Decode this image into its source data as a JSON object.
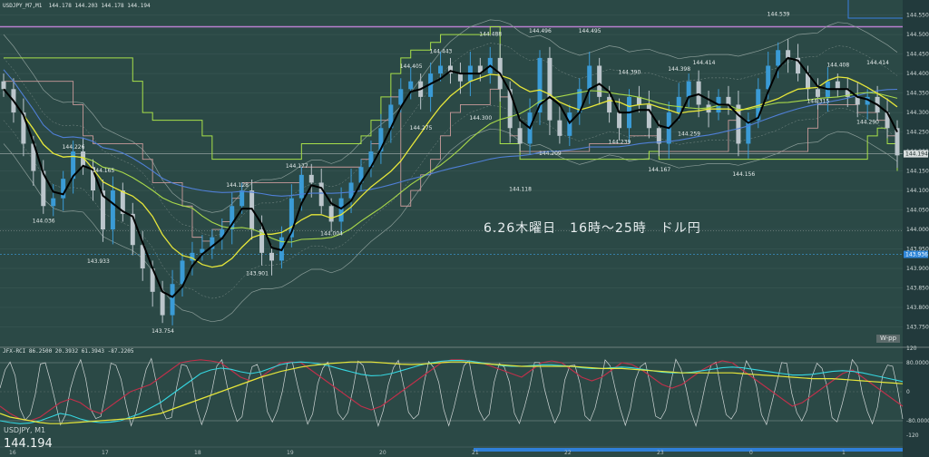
{
  "header": {
    "main_caption": "USDJPY_M7,M1  144.178 144.203 144.178 144.194",
    "oscillator_caption": "JFX-RCI 86.2500 20.3932 61.3943 -87.2205"
  },
  "annotation": "6.26木曜日　16時～25時　ドル円",
  "bottom_symbol": "USDJPY, M1",
  "bottom_price": "144.194",
  "wpp_tag": "W-pp",
  "current_price_label": "144.194",
  "blue_line_label": "143.936",
  "colors": {
    "background": "#2b4946",
    "candle_up": "#3a9bd6",
    "candle_down": "#bcc6cc",
    "ma_fast": "#000000",
    "ma_mid": "#e6e63a",
    "ma_slow": "#a8d84a",
    "ma_long": "#4f7fd6",
    "step_green": "#a8e04a",
    "step_pink": "#c99a9a",
    "rci_cyan": "#35d6e0",
    "rci_red": "#c0304a",
    "rci_yellow": "#e6e63a",
    "rci_white": "#cfd6d6",
    "level_purple": "#b97fd0"
  },
  "chart_data": [
    {
      "type": "line",
      "title": "USDJPY, M1",
      "ylim": [
        143.7,
        144.57
      ],
      "y_ticks": [
        "144.550",
        "144.500",
        "144.450",
        "144.400",
        "144.350",
        "144.300",
        "144.250",
        "144.200",
        "144.150",
        "144.100",
        "144.050",
        "144.000",
        "143.950",
        "143.900",
        "143.850",
        "143.800",
        "143.750"
      ],
      "x_ticks": [
        "16",
        "17",
        "18",
        "19",
        "20",
        "21",
        "22",
        "23",
        "0",
        "1"
      ],
      "price_labels": [
        {
          "t": 4,
          "v": 144.036,
          "text": "144.036"
        },
        {
          "t": 7,
          "v": 144.226,
          "text": "144.226"
        },
        {
          "t": 9.5,
          "v": 143.933,
          "text": "143.933"
        },
        {
          "t": 10,
          "v": 144.165,
          "text": "144.165"
        },
        {
          "t": 16,
          "v": 143.754,
          "text": "143.754"
        },
        {
          "t": 23.5,
          "v": 144.128,
          "text": "144.128"
        },
        {
          "t": 25.5,
          "v": 143.901,
          "text": "143.901"
        },
        {
          "t": 29.5,
          "v": 144.177,
          "text": "144.177"
        },
        {
          "t": 33,
          "v": 144.004,
          "text": "144.004"
        },
        {
          "t": 41,
          "v": 144.405,
          "text": "144.405"
        },
        {
          "t": 42,
          "v": 144.275,
          "text": "144.275"
        },
        {
          "t": 44,
          "v": 144.443,
          "text": "144.443"
        },
        {
          "t": 48,
          "v": 144.3,
          "text": "144.300"
        },
        {
          "t": 49,
          "v": 144.488,
          "text": "144.488"
        },
        {
          "t": 52,
          "v": 144.118,
          "text": "144.118"
        },
        {
          "t": 54,
          "v": 144.496,
          "text": "144.496"
        },
        {
          "t": 55,
          "v": 144.209,
          "text": "144.209"
        },
        {
          "t": 59,
          "v": 144.495,
          "text": "144.495"
        },
        {
          "t": 62,
          "v": 144.239,
          "text": "144.239"
        },
        {
          "t": 63,
          "v": 144.39,
          "text": "144.390"
        },
        {
          "t": 66,
          "v": 144.167,
          "text": "144.167"
        },
        {
          "t": 68,
          "v": 144.398,
          "text": "144.398"
        },
        {
          "t": 69,
          "v": 144.259,
          "text": "144.259"
        },
        {
          "t": 70.5,
          "v": 144.414,
          "text": "144.414"
        },
        {
          "t": 74.5,
          "v": 144.156,
          "text": "144.156"
        },
        {
          "t": 78,
          "v": 144.539,
          "text": "144.539"
        },
        {
          "t": 82,
          "v": 144.315,
          "text": "144.315"
        },
        {
          "t": 84,
          "v": 144.408,
          "text": "144.408"
        },
        {
          "t": 87,
          "v": 144.29,
          "text": "144.290"
        },
        {
          "t": 88,
          "v": 144.414,
          "text": "144.414"
        }
      ],
      "close": [
        144.36,
        144.3,
        144.22,
        144.15,
        144.06,
        144.08,
        144.13,
        144.2,
        144.16,
        144.1,
        144.0,
        144.1,
        144.04,
        143.96,
        143.9,
        143.84,
        143.78,
        143.86,
        143.92,
        143.94,
        143.95,
        143.98,
        144.0,
        144.06,
        144.1,
        144.0,
        143.94,
        143.92,
        143.98,
        144.08,
        144.14,
        144.12,
        144.06,
        144.02,
        144.08,
        144.12,
        144.16,
        144.2,
        144.26,
        144.32,
        144.36,
        144.38,
        144.34,
        144.4,
        144.42,
        144.4,
        144.38,
        144.42,
        144.4,
        144.44,
        144.36,
        144.26,
        144.22,
        144.3,
        144.44,
        144.28,
        144.24,
        144.3,
        144.36,
        144.42,
        144.34,
        144.3,
        144.26,
        144.34,
        144.32,
        144.26,
        144.22,
        144.3,
        144.34,
        144.38,
        144.32,
        144.3,
        144.34,
        144.32,
        144.22,
        144.28,
        144.36,
        144.42,
        144.46,
        144.44,
        144.4,
        144.36,
        144.34,
        144.38,
        144.36,
        144.34,
        144.32,
        144.34,
        144.3,
        144.26,
        144.19
      ]
    },
    {
      "type": "line",
      "title": "JFX-RCI",
      "ylim": [
        -120,
        120
      ],
      "y_ticks": [
        "120",
        "80.0000",
        "0",
        "-80.0000",
        "-120"
      ],
      "series": [
        {
          "values": [
            -40,
            -60,
            -75,
            -80,
            -70,
            -50,
            -30,
            -20,
            -30,
            -50,
            -60,
            -40,
            -20,
            0,
            10,
            20,
            40,
            60,
            80,
            85,
            88,
            85,
            80,
            60,
            40,
            30,
            40,
            60,
            80,
            82,
            80,
            60,
            40,
            20,
            0,
            -20,
            -40,
            -50,
            -40,
            -20,
            0,
            20,
            40,
            60,
            80,
            88,
            88,
            84,
            80,
            70,
            60,
            50,
            40,
            60,
            80,
            85,
            80,
            60,
            40,
            30,
            40,
            60,
            80,
            75,
            60,
            40,
            20,
            10,
            20,
            40,
            60,
            75,
            85,
            80,
            60,
            40,
            20,
            0,
            -20,
            -40,
            -30,
            -10,
            10,
            30,
            50,
            60,
            40,
            20,
            0,
            -20,
            -40
          ]
        },
        {
          "values": [
            -80,
            -85,
            -88,
            -86,
            -80,
            -70,
            -60,
            -65,
            -75,
            -82,
            -85,
            -84,
            -80,
            -70,
            -60,
            -45,
            -30,
            -10,
            10,
            30,
            50,
            60,
            65,
            62,
            55,
            50,
            55,
            65,
            75,
            80,
            82,
            80,
            76,
            70,
            62,
            55,
            48,
            44,
            45,
            50,
            58,
            66,
            74,
            80,
            84,
            86,
            86,
            84,
            80,
            76,
            72,
            70,
            70,
            72,
            74,
            74,
            72,
            70,
            66,
            64,
            64,
            66,
            68,
            66,
            62,
            58,
            54,
            52,
            52,
            54,
            58,
            62,
            66,
            68,
            66,
            62,
            58,
            54,
            50,
            46,
            46,
            48,
            52,
            56,
            58,
            56,
            52,
            46,
            40,
            34,
            28
          ]
        },
        {
          "values": [
            -60,
            -70,
            -75,
            -80,
            -85,
            -88,
            -88,
            -86,
            -84,
            -82,
            -80,
            -78,
            -76,
            -74,
            -70,
            -65,
            -60,
            -50,
            -40,
            -30,
            -20,
            -10,
            0,
            10,
            20,
            30,
            40,
            48,
            56,
            62,
            68,
            72,
            75,
            78,
            80,
            82,
            82,
            82,
            80,
            78,
            76,
            75,
            76,
            78,
            80,
            82,
            82,
            80,
            78,
            76,
            74,
            72,
            70,
            70,
            70,
            70,
            70,
            70,
            68,
            66,
            64,
            64,
            64,
            62,
            60,
            58,
            56,
            54,
            52,
            52,
            52,
            52,
            52,
            52,
            50,
            48,
            46,
            44,
            42,
            40,
            38,
            36,
            36,
            36,
            34,
            32,
            30,
            28,
            26,
            24,
            22
          ]
        }
      ]
    }
  ]
}
